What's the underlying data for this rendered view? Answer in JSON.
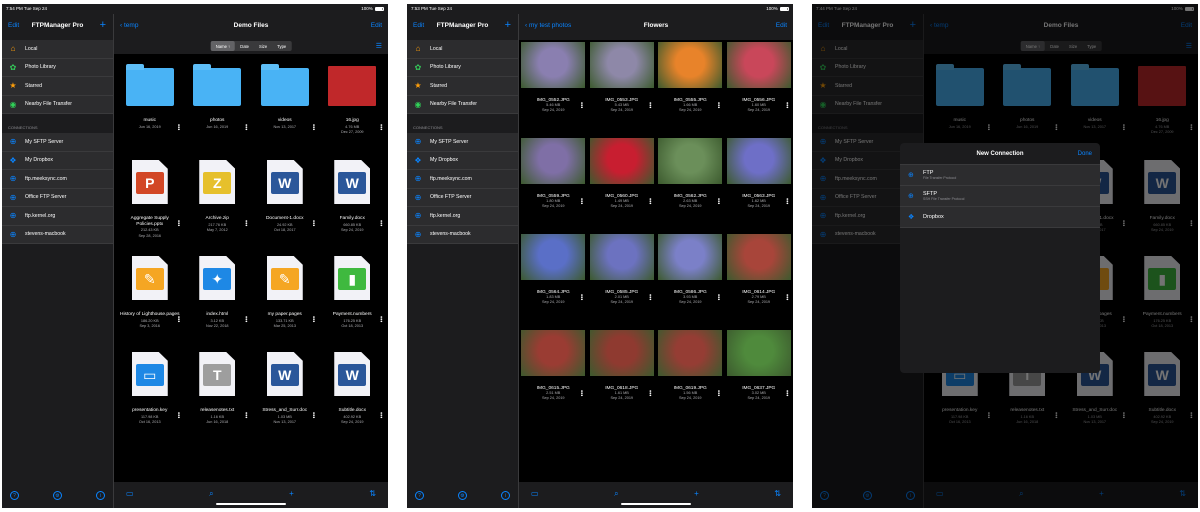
{
  "screens": [
    {
      "status": {
        "time": "7:54 PM  Tue Sep 24",
        "battery": "100%"
      },
      "sidebar": {
        "edit": "Edit",
        "title": "FTPManager Pro",
        "local_items": [
          {
            "label": "Local",
            "icon": "house-icon",
            "color": "#ff9f0a"
          },
          {
            "label": "Photo Library",
            "icon": "photos-icon",
            "color": "#34c759"
          },
          {
            "label": "Starred",
            "icon": "star-icon",
            "color": "#ff9f0a"
          },
          {
            "label": "Nearby File Transfer",
            "icon": "nearby-icon",
            "color": "#30d158"
          }
        ],
        "connections_label": "CONNECTIONS",
        "connections": [
          {
            "label": "My SFTP  Server",
            "icon": "globe-icon"
          },
          {
            "label": "My Dropbox",
            "icon": "dropbox-icon"
          },
          {
            "label": "ftp.meeksync.com",
            "icon": "globe-icon"
          },
          {
            "label": "Office FTP Server",
            "icon": "globe-icon"
          },
          {
            "label": "ftp.kernel.org",
            "icon": "globe-icon"
          },
          {
            "label": "stevens-macbook",
            "icon": "globe-icon"
          }
        ]
      },
      "main": {
        "back": "temp",
        "title": "Demo Files",
        "edit": "Edit",
        "sort": [
          "Name ↑",
          "Date",
          "Size",
          "Type"
        ],
        "files": [
          {
            "name": "music",
            "meta1": "Jun 16, 2019",
            "meta2": "",
            "kind": "folder"
          },
          {
            "name": "photos",
            "meta1": "Jun 16, 2019",
            "meta2": "",
            "kind": "folder"
          },
          {
            "name": "videos",
            "meta1": "Nov 13, 2017",
            "meta2": "",
            "kind": "folder"
          },
          {
            "name": "16.jpg",
            "meta1": "4.76 MB",
            "meta2": "Dec 27, 2009",
            "kind": "photo",
            "color": "#c0282a"
          },
          {
            "name": "Aggregate Supply Policies.pptx",
            "meta1": "212.43 KB",
            "meta2": "Sep 28, 2016",
            "kind": "doc",
            "badge": "P",
            "color": "#d24726"
          },
          {
            "name": "Archive.zip",
            "meta1": "217.76 KB",
            "meta2": "May 7, 2012",
            "kind": "doc",
            "badge": "Z",
            "color": "#e6c02c"
          },
          {
            "name": "Document-1.docx",
            "meta1": "24.92 KB",
            "meta2": "Oct 18, 2017",
            "kind": "doc",
            "badge": "W",
            "color": "#2b579a"
          },
          {
            "name": "Family.docx",
            "meta1": "660.85 KB",
            "meta2": "Sep 24, 2019",
            "kind": "doc",
            "badge": "W",
            "color": "#2b579a"
          },
          {
            "name": "History of Lighthouse.pages",
            "meta1": "186.20 KB",
            "meta2": "Sep 3, 2016",
            "kind": "doc",
            "badge": "✎",
            "color": "#f5a623"
          },
          {
            "name": "index.html",
            "meta1": "3.12 KB",
            "meta2": "Nov 22, 2018",
            "kind": "doc",
            "badge": "✦",
            "color": "#1e88e5"
          },
          {
            "name": "my paper.pages",
            "meta1": "133.71 KB",
            "meta2": "Mar 25, 2013",
            "kind": "doc",
            "badge": "✎",
            "color": "#f5a623"
          },
          {
            "name": "Payment.numbers",
            "meta1": "176.25 KB",
            "meta2": "Oct 18, 2013",
            "kind": "doc",
            "badge": "▮",
            "color": "#3fb93f"
          },
          {
            "name": "presentation.key",
            "meta1": "117.98 KB",
            "meta2": "Oct 16, 2013",
            "kind": "doc",
            "badge": "▭",
            "color": "#1e88e5"
          },
          {
            "name": "releasenotes.txt",
            "meta1": "1.16 KB",
            "meta2": "Jun 16, 2018",
            "kind": "doc",
            "badge": "T",
            "color": "#9e9e9e"
          },
          {
            "name": "Stress_and_Surr.doc",
            "meta1": "1.03 MB",
            "meta2": "Nov 13, 2017",
            "kind": "doc",
            "badge": "W",
            "color": "#2b579a"
          },
          {
            "name": "Subtitle.docx",
            "meta1": "402.92 KB",
            "meta2": "Sep 24, 2019",
            "kind": "doc",
            "badge": "W",
            "color": "#2b579a"
          }
        ]
      }
    },
    {
      "status": {
        "time": "7:53 PM  Tue Sep 24",
        "battery": "100%"
      },
      "main": {
        "back": "my test photos",
        "title": "Flowers",
        "edit": "Edit",
        "photos": [
          {
            "name": "IMG_0552.JPG",
            "size": "5.46 MB",
            "date": "Sep 24, 2019",
            "color": "#8a7fb0"
          },
          {
            "name": "IMG_0553.JPG",
            "size": "5.43 MB",
            "date": "Sep 24, 2019",
            "color": "#8e88a8"
          },
          {
            "name": "IMG_0555.JPG",
            "size": "1.66 MB",
            "date": "Sep 24, 2019",
            "color": "#e8832a"
          },
          {
            "name": "IMG_0556.JPG",
            "size": "1.60 MB",
            "date": "Sep 24, 2019",
            "color": "#c9475a"
          },
          {
            "name": "IMG_0559.JPG",
            "size": "1.80 MB",
            "date": "Sep 24, 2019",
            "color": "#7f6fa6"
          },
          {
            "name": "IMG_0560.JPG",
            "size": "1.49 MB",
            "date": "Sep 24, 2019",
            "color": "#c81e30"
          },
          {
            "name": "IMG_0562.JPG",
            "size": "2.63 MB",
            "date": "Sep 24, 2019",
            "color": "#6b8f5a"
          },
          {
            "name": "IMG_0563.JPG",
            "size": "1.62 MB",
            "date": "Sep 24, 2019",
            "color": "#6e6fc7"
          },
          {
            "name": "IMG_0564.JPG",
            "size": "1.83 MB",
            "date": "Sep 24, 2019",
            "color": "#5a6fc7"
          },
          {
            "name": "IMG_0585.JPG",
            "size": "2.01 MB",
            "date": "Sep 24, 2019",
            "color": "#6c72c0"
          },
          {
            "name": "IMG_0586.JPG",
            "size": "3.93 MB",
            "date": "Sep 24, 2019",
            "color": "#7b80c8"
          },
          {
            "name": "IMG_0614.JPG",
            "size": "2.79 MB",
            "date": "Sep 24, 2019",
            "color": "#a8453a"
          },
          {
            "name": "IMG_0615.JPG",
            "size": "2.51 MB",
            "date": "Sep 24, 2019",
            "color": "#9a3c33"
          },
          {
            "name": "IMG_0618.JPG",
            "size": "1.61 MB",
            "date": "Sep 24, 2019",
            "color": "#8f3a30"
          },
          {
            "name": "IMG_0619.JPG",
            "size": "1.56 MB",
            "date": "Sep 24, 2019",
            "color": "#953d34"
          },
          {
            "name": "IMG_0637.JPG",
            "size": "3.02 MB",
            "date": "Sep 24, 2019",
            "color": "#4f8a3c"
          }
        ]
      }
    },
    {
      "status": {
        "time": "7:44 PM  Tue Sep 24",
        "battery": "100%"
      },
      "modal": {
        "title": "New Connection",
        "done": "Done",
        "rows": [
          {
            "title": "FTP",
            "subtitle": "File Transfer Protocol",
            "icon": "globe-icon"
          },
          {
            "title": "SFTP",
            "subtitle": "SSH File Transfer Protocol",
            "icon": "globe-icon"
          },
          {
            "title": "Dropbox",
            "subtitle": "",
            "icon": "dropbox-icon"
          }
        ]
      }
    }
  ]
}
